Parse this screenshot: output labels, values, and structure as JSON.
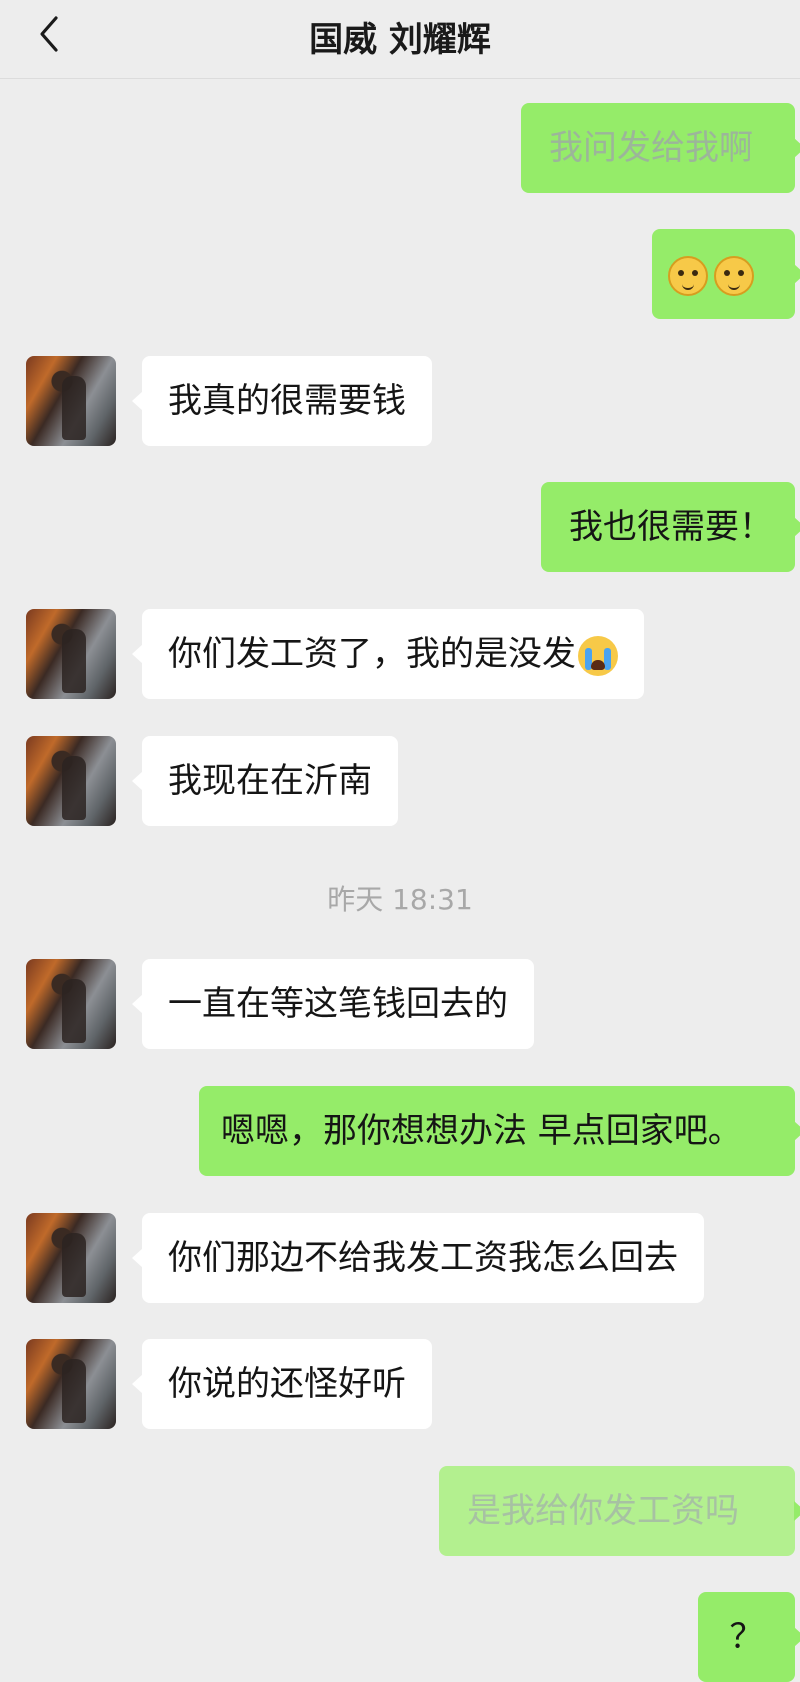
{
  "header": {
    "title": "国威 刘耀辉"
  },
  "messages": {
    "m1": "我问发给我啊",
    "m2_emojis": [
      "face-emoji",
      "face-emoji"
    ],
    "m3": "我真的很需要钱",
    "m4": "我也很需要！",
    "m5": "你们发工资了，我的是没发",
    "m6": "我现在在沂南",
    "timestamp": "昨天 18:31",
    "m7": "一直在等这笔钱回去的",
    "m8": "嗯嗯，那你想想办法 早点回家吧。",
    "m9": "你们那边不给我发工资我怎么回去",
    "m10": "你说的还怪好听",
    "m11": "是我给你发工资吗",
    "m12": "？"
  },
  "colors": {
    "outgoing": "#95ec69",
    "incoming": "#ffffff",
    "background": "#ededed"
  }
}
